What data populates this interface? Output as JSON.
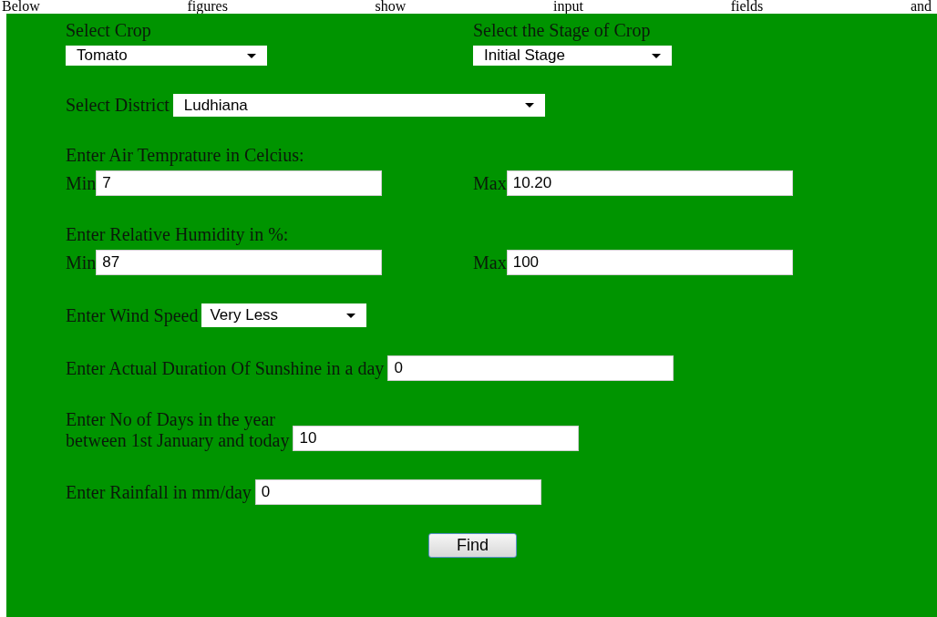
{
  "intro_text": "Below figures show input fields and",
  "form": {
    "crop": {
      "label": "Select Crop",
      "value": "Tomato"
    },
    "stage": {
      "label": "Select the Stage of Crop",
      "value": "Initial Stage"
    },
    "district": {
      "label": "Select District",
      "value": "Ludhiana"
    },
    "air_temperature": {
      "label": "Enter Air Temprature in Celcius:",
      "min_label": "Min",
      "min_value": "7",
      "max_label": "Max",
      "max_value": "10.20"
    },
    "humidity": {
      "label": "Enter Relative Humidity in %:",
      "min_label": "Min",
      "min_value": "87",
      "max_label": "Max",
      "max_value": "100"
    },
    "wind_speed": {
      "label": "Enter Wind Speed",
      "value": "Very Less"
    },
    "sunshine": {
      "label": "Enter Actual Duration Of Sunshine in a day",
      "value": "0"
    },
    "days": {
      "label_lines": [
        "Enter No of Days in the year",
        "between 1st January and today"
      ],
      "value": "10"
    },
    "rainfall": {
      "label": "Enter Rainfall in mm/day",
      "value": "0"
    },
    "button": "Find"
  }
}
